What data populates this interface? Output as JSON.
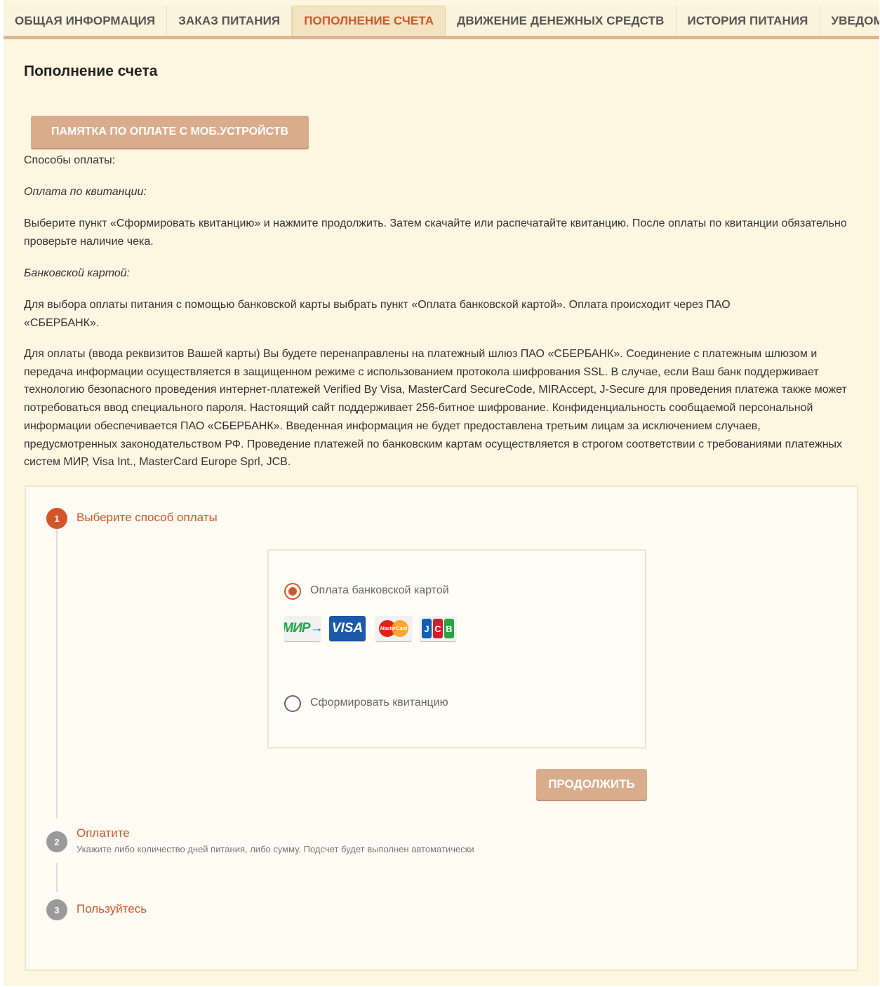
{
  "tabs": [
    {
      "label": "ОБЩАЯ ИНФОРМАЦИЯ",
      "active": false
    },
    {
      "label": "ЗАКАЗ ПИТАНИЯ",
      "active": false
    },
    {
      "label": "ПОПОЛНЕНИЕ СЧЕТА",
      "active": true
    },
    {
      "label": "ДВИЖЕНИЕ ДЕНЕЖНЫХ СРЕДСТВ",
      "active": false
    },
    {
      "label": "ИСТОРИЯ ПИТАНИЯ",
      "active": false
    },
    {
      "label": "УВЕДОМЛЕНИЯ",
      "active": false
    }
  ],
  "page": {
    "title": "Пополнение счета",
    "memo_button": "ПАМЯТКА ПО ОПЛАТЕ С МОБ.УСТРОЙСТВ",
    "methods_label": "Способы оплаты:",
    "receipt_heading": "Оплата по квитанции:",
    "receipt_text": "Выберите пункт «Сформировать квитанцию» и нажмите продолжить. Затем скачайте или распечатайте квитанцию. После оплаты по квитанции обязательно проверьте наличие чека.",
    "card_heading": "Банковской картой:",
    "card_text": "Для выбора оплаты питания с помощью банковской карты выбрать пункт «Оплата банковской картой». Оплата происходит через ПАО «СБЕРБАНК».",
    "security_text": "Для оплаты (ввода реквизитов Вашей карты) Вы будете перенаправлены на платежный шлюз ПАО «СБЕРБАНК». Соединение с платежным шлюзом и передача информации осуществляется в защищенном режиме с использованием протокола шифрования SSL. В случае, если Ваш банк поддерживает технологию безопасного проведения интернет-платежей Verified By Visa, MasterCard SecureCode, MIRAccept, J-Secure для проведения платежа также может потребоваться ввод специального пароля. Настоящий сайт поддерживает 256-битное шифрование. Конфиденциальность сообщаемой персональной информации обеспечивается ПАО «СБЕРБАНК». Введенная информация не будет предоставлена третьим лицам за исключением случаев, предусмотренных законодательством РФ. Проведение платежей по банковским картам осуществляется в строгом соответствии с требованиями платежных систем МИР, Visa Int., MasterCard Europe Sprl, JCB."
  },
  "wizard": {
    "steps": [
      {
        "num": "1",
        "title": "Выберите способ оплаты",
        "subtitle": "",
        "color": "#d2562a"
      },
      {
        "num": "2",
        "title": "Оплатите",
        "subtitle": "Укажите либо количество дней питания, либо сумму. Подсчет будет выполнен автоматически",
        "color": "#9a9a9a"
      },
      {
        "num": "3",
        "title": "Пользуйтесь",
        "subtitle": "",
        "color": "#9a9a9a"
      }
    ],
    "options": [
      {
        "label": "Оплата банковской картой",
        "selected": true
      },
      {
        "label": "Сформировать квитанцию",
        "selected": false
      }
    ],
    "card_logos": {
      "mir": "МИР",
      "visa": "VISA",
      "mastercard": "MasterCard",
      "jcb": [
        "J",
        "C",
        "B"
      ]
    },
    "continue_button": "ПРОДОЛЖИТЬ"
  },
  "colors": {
    "accent": "#d2562a",
    "button": "#d9ac8c",
    "background": "#fdf6e0"
  }
}
